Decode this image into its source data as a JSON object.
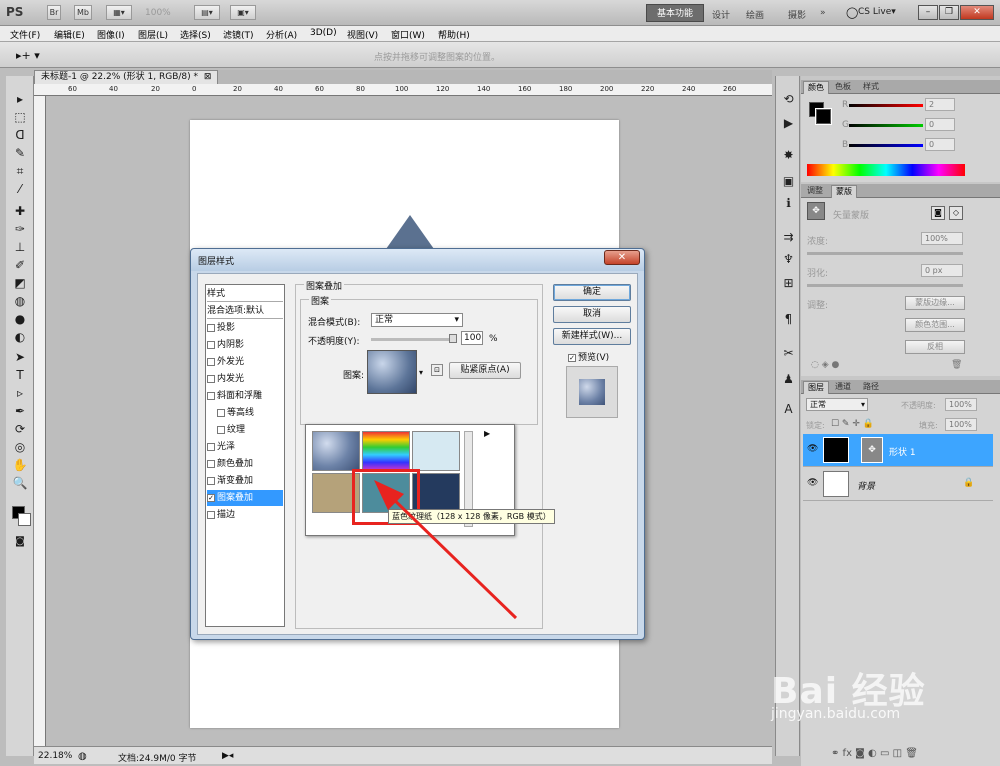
{
  "app": {
    "logo": "PS",
    "zoom_menu": "100%",
    "workspaces": [
      "基本功能",
      "设计",
      "绘画",
      "摄影",
      "»"
    ],
    "cs_live": "CS Live▾"
  },
  "menu": [
    "文件(F)",
    "编辑(E)",
    "图像(I)",
    "图层(L)",
    "选择(S)",
    "滤镜(T)",
    "分析(A)",
    "3D(D)",
    "视图(V)",
    "窗口(W)",
    "帮助(H)"
  ],
  "options": {
    "hint": "点按并拖移可调整图案的位置。"
  },
  "document": {
    "tab_title": "未标题-1 @ 22.2% (形状 1, RGB/8) *",
    "ruler_numbers": [
      "60",
      "40",
      "20",
      "0",
      "20",
      "40",
      "60",
      "80",
      "100",
      "120",
      "140",
      "160",
      "180",
      "200",
      "220",
      "240",
      "260"
    ]
  },
  "status": {
    "zoom": "22.18%",
    "doc": "文档:24.9M/0 字节"
  },
  "dialog": {
    "title": "图层样式",
    "styles": [
      {
        "label": "样式",
        "check": false
      },
      {
        "label": "混合选项:默认",
        "check": false
      },
      {
        "label": "投影",
        "check": true,
        "checked": false
      },
      {
        "label": "内阴影",
        "check": true,
        "checked": false
      },
      {
        "label": "外发光",
        "check": true,
        "checked": false
      },
      {
        "label": "内发光",
        "check": true,
        "checked": false
      },
      {
        "label": "斜面和浮雕",
        "check": true,
        "checked": false
      },
      {
        "label": "等高线",
        "check": true,
        "checked": false,
        "indent": true
      },
      {
        "label": "纹理",
        "check": true,
        "checked": false,
        "indent": true
      },
      {
        "label": "光泽",
        "check": true,
        "checked": false
      },
      {
        "label": "颜色叠加",
        "check": true,
        "checked": false
      },
      {
        "label": "渐变叠加",
        "check": true,
        "checked": false
      },
      {
        "label": "图案叠加",
        "check": true,
        "checked": true,
        "selected": true
      },
      {
        "label": "描边",
        "check": true,
        "checked": false
      }
    ],
    "section_title": "图案叠加",
    "group_title": "图案",
    "blend_label": "混合模式(B):",
    "blend_value": "正常",
    "opacity_label": "不透明度(Y):",
    "opacity_value": "100",
    "opacity_unit": "%",
    "opacity_fraction": 1.0,
    "pattern_label": "图案:",
    "snap_button": "贴紧原点(A)",
    "ok": "确定",
    "cancel": "取消",
    "new_style": "新建样式(W)...",
    "preview": "预览(V)",
    "preview_checked": true,
    "tooltip": "蓝色纹理纸（128 x 128 像素，RGB 模式）",
    "swatches": [
      "bubbles",
      "rainbow",
      "pale-blue",
      "tan-paper",
      "blue-texture-paper",
      "navy-texture"
    ]
  },
  "colors": {
    "accent": "#3399ff",
    "selected_layer": "#3da5ff",
    "arrow_red": "#e8231f",
    "tab_dark": "#6d6d6d"
  },
  "panels": {
    "color_tabs": [
      "颜色",
      "色板",
      "样式"
    ],
    "channels": [
      {
        "label": "R",
        "value": "2"
      },
      {
        "label": "G",
        "value": "0"
      },
      {
        "label": "B",
        "value": "0"
      }
    ],
    "adjust_tabs": [
      "调整",
      "蒙版"
    ],
    "mask_title": "矢量蒙版",
    "density_label": "浓度:",
    "density_value": "100%",
    "feather_label": "羽化:",
    "feather_value": "0 px",
    "refine_label": "调整:",
    "mask_edge": "蒙版边缘...",
    "color_range": "颜色范围...",
    "invert": "反相",
    "layer_tabs": [
      "图层",
      "通道",
      "路径"
    ],
    "blend_mode": "正常",
    "opacity_label": "不透明度:",
    "opacity_value": "100%",
    "lock_label": "锁定:",
    "fill_label": "填充:",
    "fill_value": "100%",
    "layers": [
      {
        "name": "形状 1",
        "selected": true
      },
      {
        "name": "背景",
        "selected": false,
        "locked": true
      }
    ]
  },
  "watermark": {
    "brand": "Bai 经验",
    "url": "jingyan.baidu.com"
  }
}
